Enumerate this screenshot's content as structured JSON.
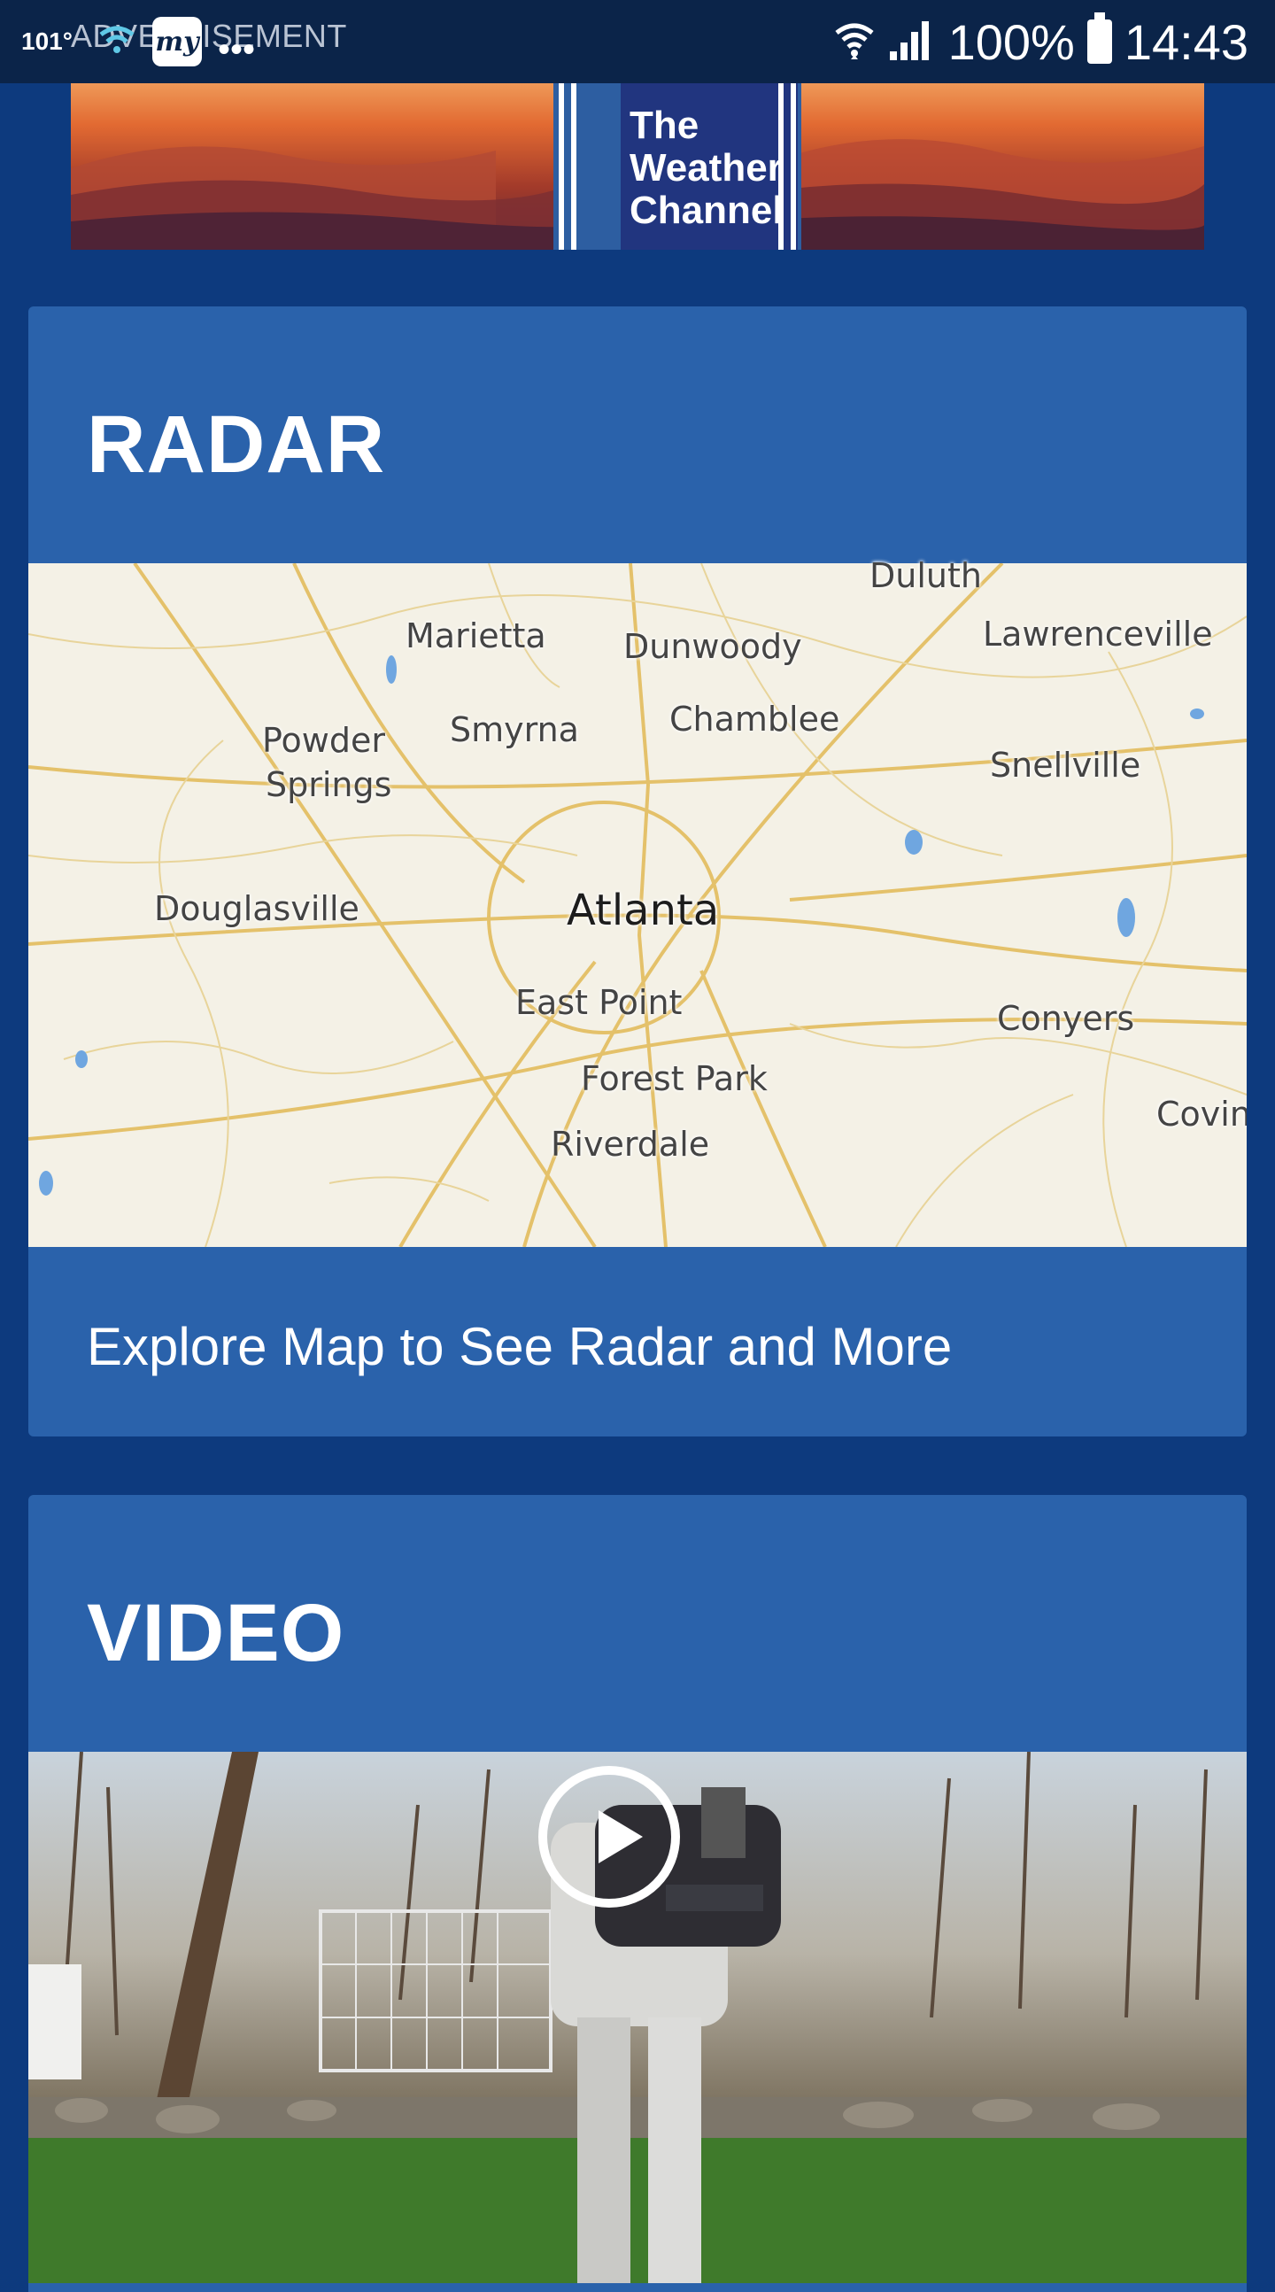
{
  "status_bar": {
    "temperature": "101°",
    "ad_label": "ADVERTISEMENT",
    "notification_app": "my",
    "more_dots": "•••",
    "battery_text": "100%",
    "clock": "14:43"
  },
  "ad": {
    "brand_line_1": "The",
    "brand_line_2": "Weather",
    "brand_line_3": "Channel"
  },
  "radar": {
    "title": "RADAR",
    "explore_link": "Explore Map to See Radar and More",
    "map_labels": {
      "duluth": "Duluth",
      "marietta": "Marietta",
      "dunwoody": "Dunwoody",
      "lawrenceville": "Lawrenceville",
      "powder": "Powder",
      "springs": "Springs",
      "smyrna": "Smyrna",
      "chamblee": "Chamblee",
      "snellville": "Snellville",
      "douglasville": "Douglasville",
      "atlanta": "Atlanta",
      "east_point": "East Point",
      "conyers": "Conyers",
      "forest_park": "Forest Park",
      "covington": "Covin",
      "riverdale": "Riverdale"
    }
  },
  "video": {
    "title": "VIDEO"
  },
  "colors": {
    "page_background": "#0d3a7e",
    "card_background": "#2a62ab",
    "status_bar": "#0b2449",
    "map_background": "#f4f1e6",
    "map_roads": "#e4c16a",
    "map_water": "#6fa6e0"
  }
}
